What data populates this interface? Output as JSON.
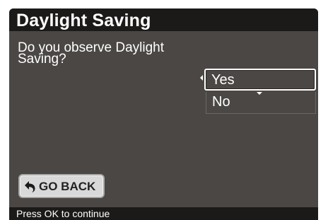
{
  "dialog": {
    "title": "Daylight Saving",
    "question_line1": "Do you observe Daylight",
    "question_line2": "Saving?"
  },
  "options": [
    {
      "label": "Yes",
      "selected": true
    },
    {
      "label": "No",
      "selected": false
    }
  ],
  "buttons": {
    "go_back_label": "GO BACK",
    "go_back_icon": "return-arrow-icon"
  },
  "status": {
    "text": "Press OK to continue"
  },
  "colors": {
    "panel_background": "#4a4744",
    "title_bar_background": "#1c1a19",
    "text": "#ffffff",
    "button_background": "#d9d9d9"
  }
}
